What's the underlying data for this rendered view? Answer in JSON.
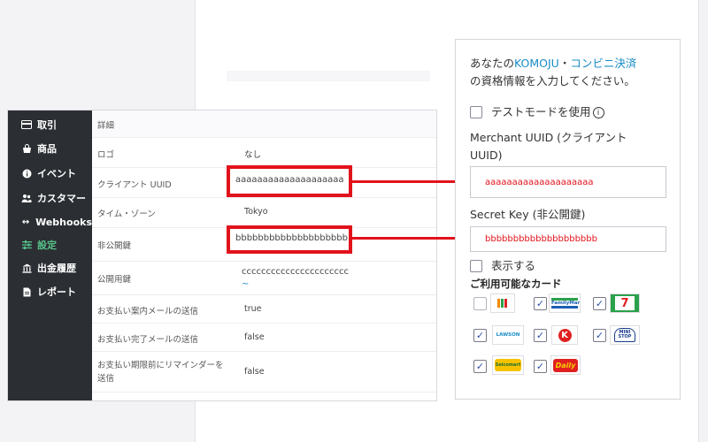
{
  "sidebar": {
    "items": [
      {
        "label": "取引",
        "icon": "credit-card-icon"
      },
      {
        "label": "商品",
        "icon": "bag-icon"
      },
      {
        "label": "イベント",
        "icon": "info-icon"
      },
      {
        "label": "カスタマー",
        "icon": "users-icon"
      },
      {
        "label": "Webhooks",
        "icon": "arrows-icon"
      },
      {
        "label": "設定",
        "icon": "sliders-icon",
        "active": true
      },
      {
        "label": "出金履歴",
        "icon": "bank-icon"
      },
      {
        "label": "レポート",
        "icon": "document-icon"
      }
    ]
  },
  "details": {
    "header": "詳細",
    "rows": [
      {
        "label": "ロゴ",
        "value": "なし"
      },
      {
        "label": "クライアント UUID",
        "value": "aaaaaaaaaaaaaaaaaaaa"
      },
      {
        "label": "タイム・ゾーン",
        "value": "Tokyo"
      },
      {
        "label": "非公開鍵",
        "value": "bbbbbbbbbbbbbbbbbbbb"
      },
      {
        "label": "公開用鍵",
        "value": "cccccccccccccccccccccc"
      },
      {
        "label": "お支払い案内メールの送信",
        "value": "true"
      },
      {
        "label": "お支払い完了メールの送信",
        "value": "false"
      },
      {
        "label": "お支払い期限前にリマインダーを送信",
        "value": "false"
      }
    ]
  },
  "form": {
    "intro_prefix": "あなたの",
    "intro_link1": "KOMOJU",
    "intro_sep": "・",
    "intro_link2": "コンビニ決済",
    "intro_line2": "の資格情報を入力してください。",
    "test_mode_label": "テストモードを使用",
    "merchant_label_1": "Merchant UUID (クライアント",
    "merchant_label_2": "UUID)",
    "merchant_value": "aaaaaaaaaaaaaaaaaaaa",
    "secret_label": "Secret Key (非公開鍵)",
    "secret_value": "bbbbbbbbbbbbbbbbbbbb",
    "show_label": "表示する",
    "cards_label": "ご利用可能なカード",
    "stores": [
      {
        "name": "seven-eleven",
        "logo_text": "",
        "checked": false
      },
      {
        "name": "FamilyMart",
        "logo_text": "FamilyMart",
        "checked": true
      },
      {
        "name": "7-Eleven",
        "logo_text": "7",
        "checked": true
      },
      {
        "name": "LAWSON",
        "logo_text": "LAWSON",
        "checked": true
      },
      {
        "name": "Circle K",
        "logo_text": "K",
        "checked": true
      },
      {
        "name": "MINISTOP",
        "logo_text": "MINI STOP",
        "checked": true
      },
      {
        "name": "Seicomart",
        "logo_text": "Seicomart",
        "checked": true
      },
      {
        "name": "Daily",
        "logo_text": "Daily",
        "checked": true
      }
    ]
  },
  "colors": {
    "highlight": "#e1121b",
    "link": "#1a8cc9",
    "sidebar": "#2b2f33",
    "active": "#56c28a"
  }
}
